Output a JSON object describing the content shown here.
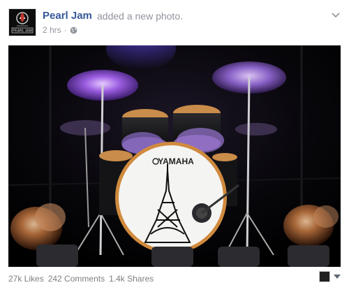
{
  "post": {
    "page_name": "Pearl Jam",
    "action_text": "added a new photo.",
    "timestamp": "2 hrs",
    "separator": "·",
    "privacy_icon": "globe-icon",
    "options_icon": "chevron-down-icon",
    "avatar_text": "PEARL JAM"
  },
  "photo": {
    "brand_text": "YAMAHA",
    "description_icon": "drum-kit-photo"
  },
  "stats": {
    "likes": "27k Likes",
    "comments": "242 Comments",
    "shares": "1.4k Shares"
  },
  "colors": {
    "link": "#365899",
    "muted": "#90949c",
    "footer_text": "#7f7f7f"
  }
}
